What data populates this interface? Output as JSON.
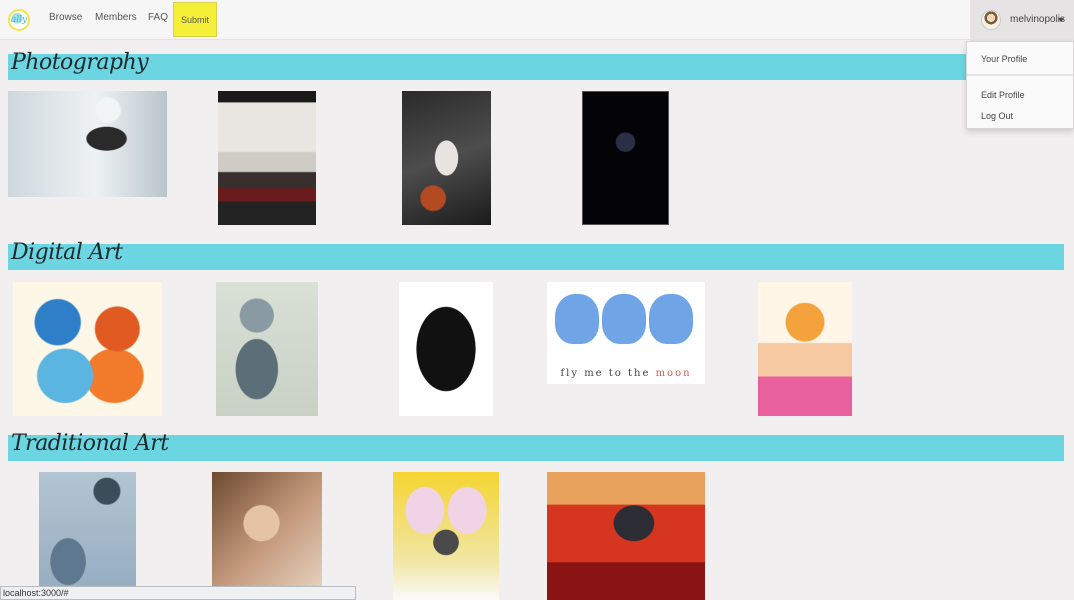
{
  "nav": {
    "logo_text": "ally",
    "links": [
      "Browse",
      "Members",
      "FAQ"
    ],
    "submit_label": "Submit"
  },
  "user": {
    "name": "melvinopolis",
    "menu": {
      "your_profile": "Your Profile",
      "edit_profile": "Edit Profile",
      "log_out": "Log Out"
    }
  },
  "sections": [
    {
      "title": "Photography",
      "item_count": 4
    },
    {
      "title": "Digital Art",
      "item_count": 5
    },
    {
      "title": "Traditional Art",
      "item_count": 4
    }
  ],
  "artwork_text": {
    "caption_prefix": "fly me to the ",
    "caption_highlight": "moon"
  },
  "status_url": "localhost:3000/#"
}
